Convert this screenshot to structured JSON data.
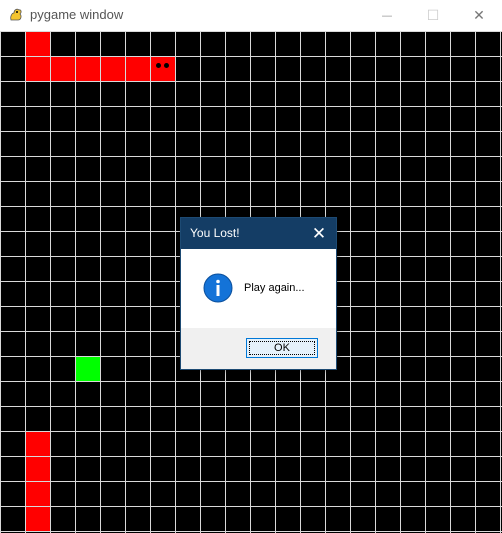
{
  "window": {
    "title": "pygame window",
    "minimize_glyph": "—",
    "maximize_glyph": "☐",
    "close_glyph": "✕"
  },
  "game": {
    "grid_rows": 20,
    "grid_cols": 20,
    "snake_color": "#ff0000",
    "snack_color": "#00ff00",
    "grid_line_color": "#ffffff",
    "background_color": "#000000",
    "snake_cells": [
      [
        1,
        0
      ],
      [
        1,
        1
      ],
      [
        2,
        1
      ],
      [
        3,
        1
      ],
      [
        4,
        1
      ],
      [
        5,
        1
      ],
      [
        6,
        1
      ],
      [
        1,
        16
      ],
      [
        1,
        17
      ],
      [
        1,
        18
      ],
      [
        1,
        19
      ]
    ],
    "snake_head": [
      6,
      1
    ],
    "snack_cell": [
      3,
      13
    ]
  },
  "dialog": {
    "title": "You Lost!",
    "close_glyph": "✕",
    "message": "Play again...",
    "ok_label": "OK",
    "icon": "info-icon"
  }
}
